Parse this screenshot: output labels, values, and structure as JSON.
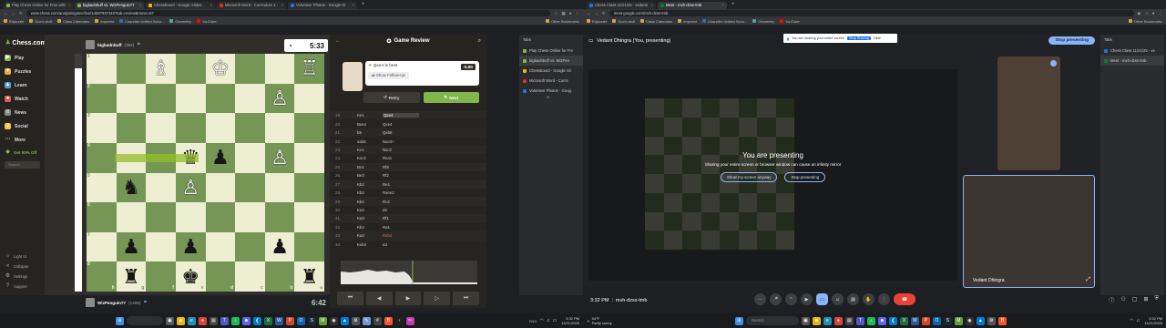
{
  "left": {
    "tabs": [
      {
        "label": "Play Chess Online for Free with",
        "color": "#81b64c",
        "active": false
      },
      {
        "label": "bigbadnbuff vs. WizPenguin77",
        "color": "#81b64c",
        "active": true
      },
      {
        "label": "Chessboard - Google Slides",
        "color": "#f4b400",
        "active": false
      },
      {
        "label": "Microsoft Word - Curriculum 1 -",
        "color": "#d93025",
        "active": false
      },
      {
        "label": "Volunteer Photos - Google Dr",
        "color": "#1a73e8",
        "active": false
      }
    ],
    "url": "www.chess.com/analysis/game/live/14587937440?tab=review&move=57",
    "bookmarks": [
      "Edpuzzle",
      "Doc's stuff",
      "Class Calendars",
      "Importnt",
      "Chandler Unified Scho...",
      "Geometry",
      "YouTube"
    ],
    "bookmarks_right": "Other Bookmarks",
    "side_tabs": {
      "header": "Tabs",
      "items": [
        "Play Chess Online for Fre",
        "bigbadnbuff vs. WizPen",
        "Chessboard - Google Sli",
        "Microsoft Word - Curric",
        "Volunteer Photos - Goog"
      ]
    },
    "chess_nav": {
      "logo": "Chess.com",
      "items": [
        {
          "label": "Play",
          "icon": "play-icon",
          "color": "#81b64c"
        },
        {
          "label": "Puzzles",
          "icon": "puzzle-icon",
          "color": "#f7a33b"
        },
        {
          "label": "Learn",
          "icon": "learn-icon",
          "color": "#5b9bd5"
        },
        {
          "label": "Watch",
          "icon": "watch-icon",
          "color": "#e05a4f"
        },
        {
          "label": "News",
          "icon": "news-icon",
          "color": "#bbbbbb"
        },
        {
          "label": "Social",
          "icon": "social-icon",
          "color": "#f4c542"
        },
        {
          "label": "More",
          "icon": "more-icon",
          "color": "#bbbbbb"
        }
      ],
      "promo": "Get 50% Off",
      "search_placeholder": "Search",
      "bottom": [
        "Light UI",
        "Collapse",
        "Settings",
        "Support"
      ]
    },
    "top_player": {
      "name": "bigbadnbuff",
      "rating": "(392)",
      "clock": "5:33"
    },
    "bottom_player": {
      "name": "WizPenguin77",
      "rating": "(1406)",
      "clock": "6:42"
    },
    "board": [
      [
        "",
        "",
        "♗",
        "",
        "♔",
        "",
        "",
        "♖"
      ],
      [
        "",
        "",
        "",
        "",
        "",
        "",
        "♙",
        ""
      ],
      [
        "",
        "",
        "",
        "",
        "",
        "",
        "",
        ""
      ],
      [
        "",
        "",
        "",
        "♛",
        "♟",
        "",
        "♙",
        ""
      ],
      [
        "",
        "♞",
        "",
        "♙",
        "",
        "",
        "",
        ""
      ],
      [
        "",
        "",
        "",
        "",
        "",
        "",
        "",
        ""
      ],
      [
        "",
        "♟",
        "",
        "♟",
        "",
        "",
        "♟",
        ""
      ],
      [
        "",
        "♜",
        "",
        "♚",
        "",
        "",
        "",
        "♜"
      ]
    ],
    "ranks": [
      "1",
      "2",
      "3",
      "4",
      "5",
      "6",
      "7",
      "8"
    ],
    "files": [
      "h",
      "g",
      "f",
      "e",
      "d",
      "c",
      "b",
      "a"
    ],
    "review": {
      "title": "Game Review",
      "best_move_text": "Qxe4 is best",
      "eval": "-5.80",
      "follow_up": "Show Follow-Up",
      "retry": "Retry",
      "next": "Next",
      "moves": [
        {
          "n": "19.",
          "w": "Ke1",
          "b": "Qxe4"
        },
        {
          "n": "20.",
          "w": "Bxe4",
          "b": "Qxe4"
        },
        {
          "n": "21.",
          "w": "b5",
          "b": "Qxb5"
        },
        {
          "n": "22.",
          "w": "axb6",
          "b": "Nxe3+"
        },
        {
          "n": "23.",
          "w": "Kc1",
          "b": "Nxc2"
        },
        {
          "n": "24.",
          "w": "Kxc2",
          "b": "Rxa1"
        },
        {
          "n": "25.",
          "w": "Bc4",
          "b": "Rf8"
        },
        {
          "n": "26.",
          "w": "Be3",
          "b": "Rf2"
        },
        {
          "n": "27.",
          "w": "Kb2",
          "b": "Re1"
        },
        {
          "n": "28.",
          "w": "Kb3",
          "b": "Rxee2"
        },
        {
          "n": "29.",
          "w": "Kb4",
          "b": "Rc2"
        },
        {
          "n": "30.",
          "w": "Ka4",
          "b": "a5"
        },
        {
          "n": "31.",
          "w": "Ka3",
          "b": "Rf1"
        },
        {
          "n": "32.",
          "w": "Kb4",
          "b": "Ra1"
        },
        {
          "n": "33.",
          "w": "Ka4",
          "b": "Rxb4"
        },
        {
          "n": "34.",
          "w": "Kxb4",
          "b": "a3"
        }
      ]
    }
  },
  "right": {
    "tabs": [
      {
        "label": "Chess Class 11/21/25 - vedanti",
        "color": "#1a73e8",
        "active": false
      },
      {
        "label": "Meet - mvh-dzss-tmb",
        "color": "#00832d",
        "active": true
      }
    ],
    "url": "meet.google.com/mvh-dzss-tmb",
    "bookmarks": [
      "Edpuzzle",
      "Doc's stuff",
      "Class Calendars",
      "Importnt",
      "Chandler Unified Scho...",
      "Geometry",
      "YouTube"
    ],
    "bookmarks_right": "Other Bookmarks",
    "side_tabs": {
      "header": "Tabs",
      "items": [
        "Chess Class 11/21/25 - ve",
        "Meet - mvh-dzss-tmb"
      ]
    },
    "presenter": "Vedant Dhingra (You, presenting)",
    "share_tip": "You are sharing your entire screen",
    "share_stop": "Stop Sharing",
    "share_hide": "Hide",
    "stop_presenting": "Stop presenting",
    "presenting_title": "You are presenting",
    "presenting_sub": "Sharing your entire screen or browser window can cause an infinity mirror",
    "show_anyway": "Show my screen anyway",
    "stop_btn": "Stop presenting",
    "self_name": "Vedant Dhingra",
    "time": "3:32 PM",
    "code": "mvh-dzss-tmb"
  },
  "taskbar": {
    "search": "Search",
    "weather_temp": "54°F",
    "weather_desc": "Partly sunny",
    "time": "3:32 PM",
    "date": "11/21/2025",
    "lang": "ENG"
  }
}
